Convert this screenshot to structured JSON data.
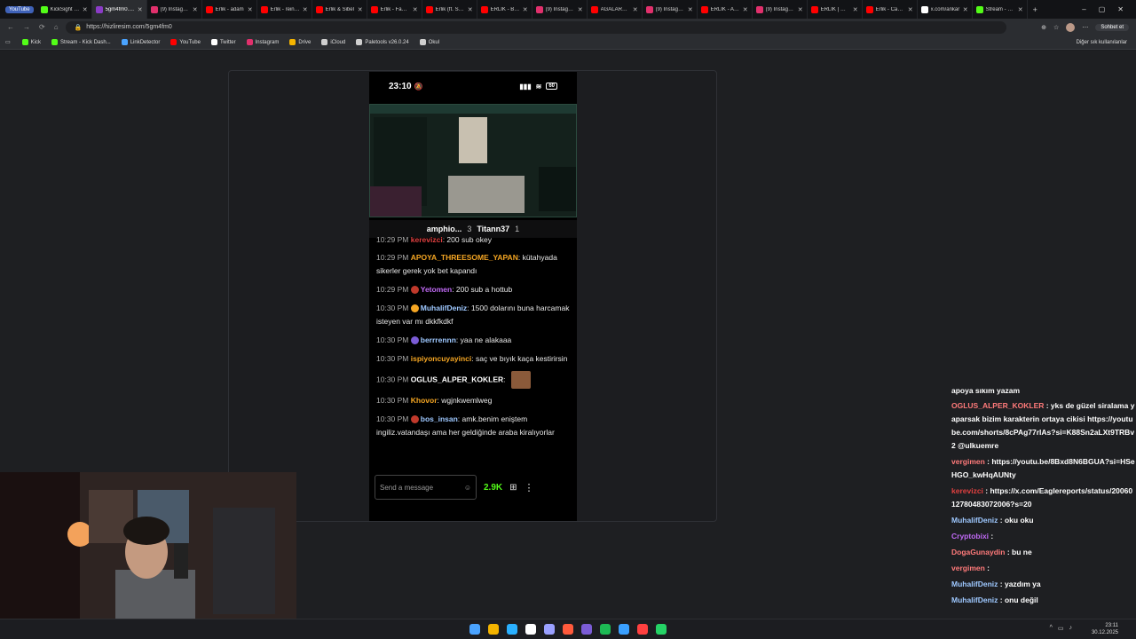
{
  "browser": {
    "youtube_pill": "YouTube",
    "tabs": [
      {
        "title": "KickSight Lin",
        "color": "#53fc18"
      },
      {
        "title": "5gm4fm0.pn",
        "color": "#8b3cc7",
        "active": true
      },
      {
        "title": "(9) Instagram",
        "color": "#e1306c"
      },
      {
        "title": "Erlik - adam",
        "color": "#ff0000"
      },
      {
        "title": "Erlik - reinca",
        "color": "#ff0000"
      },
      {
        "title": "Erlik & Sibel",
        "color": "#ff0000"
      },
      {
        "title": "Erlik - Family",
        "color": "#ff0000"
      },
      {
        "title": "Erlik (ft. Sibe",
        "color": "#ff0000"
      },
      {
        "title": "ERLİK - Bugü",
        "color": "#ff0000"
      },
      {
        "title": "(9) Instagram",
        "color": "#e1306c"
      },
      {
        "title": "AGALARLA C",
        "color": "#ff0000"
      },
      {
        "title": "(9) Instagram",
        "color": "#e1306c"
      },
      {
        "title": "ERLİK - ADA",
        "color": "#ff0000"
      },
      {
        "title": "(9) Instagram",
        "color": "#e1306c"
      },
      {
        "title": "ERLIK | Welc",
        "color": "#ff0000"
      },
      {
        "title": "Erlik - Cavs 1",
        "color": "#ff0000"
      },
      {
        "title": "x.com/ankar",
        "color": "#ffffff"
      },
      {
        "title": "Stream - Kick",
        "color": "#53fc18"
      }
    ],
    "url": "https://hizliresim.com/5gm4fm0",
    "chat_button": "Sohbet et",
    "bookmarks": [
      {
        "label": "Kick",
        "color": "#53fc18"
      },
      {
        "label": "Stream - Kick Dash...",
        "color": "#53fc18"
      },
      {
        "label": "LinkDetector",
        "color": "#4aa3ff"
      },
      {
        "label": "YouTube",
        "color": "#ff0000"
      },
      {
        "label": "Twitter",
        "color": "#ffffff"
      },
      {
        "label": "Instagram",
        "color": "#e1306c"
      },
      {
        "label": "Drive",
        "color": "#f4b400"
      },
      {
        "label": "iCloud",
        "color": "#cfcfcf"
      },
      {
        "label": "Paletools v26.0.24",
        "color": "#cfcfcf"
      },
      {
        "label": "Okul",
        "color": "#cfcfcf"
      }
    ],
    "other_bookmarks": "Diğer sık kullanılanlar"
  },
  "phone": {
    "time": "23:10",
    "battery": "60",
    "video_users": {
      "left": "amphio...",
      "left_count": "3",
      "right": "Titann37",
      "right_count": "1"
    },
    "partial_top": {
      "time": "10:29 PM",
      "user": "kerevizci",
      "text": ": 200 sub okey"
    },
    "messages": [
      {
        "time": "10:29 PM",
        "user": "APOYA_THREESOME_YAPAN",
        "color": "#f5a623",
        "badge": "",
        "text": ": kütahyada sikerler gerek yok bet kapandı"
      },
      {
        "time": "10:29 PM",
        "user": "Yetomen",
        "color": "#c06af5",
        "badge": "#c0392b",
        "text": ": 200 sub a hottub"
      },
      {
        "time": "10:30 PM",
        "user": "MuhalifDeniz",
        "color": "#9ec8ff",
        "badge": "#f5a623",
        "text": ": 1500 dolarını buna harcamak isteyen var mı dkkfkdkf"
      },
      {
        "time": "10:30 PM",
        "user": "berrrennn",
        "color": "#9ec8ff",
        "badge": "#7b5cd6",
        "text": ": yaa ne alakaaa"
      },
      {
        "time": "10:30 PM",
        "user": "ispiyoncuyayinci",
        "color": "#f5a623",
        "badge": "",
        "text": ": saç ve bıyık kaça kestirirsin"
      },
      {
        "time": "10:30 PM",
        "user": "OGLUS_ALPER_KOKLER",
        "color": "#ffffff",
        "badge": "",
        "text": ":",
        "emote": true
      },
      {
        "time": "10:30 PM",
        "user": "Khovor",
        "color": "#f5a623",
        "badge": "",
        "text": ": wgjnkwemlweg"
      },
      {
        "time": "10:30 PM",
        "user": "bos_insan",
        "color": "#9ec8ff",
        "badge": "#c0392b",
        "text": ": amk.benim eniştem ingiliz.vatandaşı ama her geldiğinde araba kiralıyorlar"
      }
    ],
    "input_placeholder": "Send a message",
    "kicks": "2.9K"
  },
  "side_chat": {
    "partial_top": "apoya sikim yazam",
    "messages": [
      {
        "user": "OGLUS_ALPER_KOKLER",
        "color": "#ff7a7a",
        "text": " : yks de güzel siralama yaparsak bizim karakterin ortaya cikisi https://youtube.com/shorts/8cPAg77rIAs?si=K88Sn2aLXt9TRBv2 @ulkuemre"
      },
      {
        "user": "vergimen",
        "color": "#ff7a7a",
        "text": " : https://youtu.be/8Bxd8N6BGUA?si=HSeHGO_kwHqAUNty"
      },
      {
        "user": "kerevizci",
        "color": "#e04040",
        "text": " : https://x.com/Eaglereports/status/2006012780483072006?s=20"
      },
      {
        "user": "MuhalifDeniz",
        "color": "#9ec8ff",
        "text": " : oku oku"
      },
      {
        "user": "Cryptobixi",
        "color": "#c06af5",
        "text": " :"
      },
      {
        "user": "DogaGunaydin",
        "color": "#ff7a7a",
        "text": " : bu ne"
      },
      {
        "user": "vergimen",
        "color": "#ff7a7a",
        "text": " :"
      },
      {
        "user": "MuhalifDeniz",
        "color": "#9ec8ff",
        "text": " : yazdım ya"
      },
      {
        "user": "MuhalifDeniz",
        "color": "#9ec8ff",
        "text": " : onu değil"
      }
    ]
  },
  "taskbar": {
    "time": "23:11",
    "date": "30.12.2025",
    "apps": [
      "#4aa3ff",
      "#f4b400",
      "#2ab0ff",
      "#ffffff",
      "#9aa0ff",
      "#ff5a3c",
      "#7b5cd6",
      "#1db954",
      "#3aa0ff",
      "#ff4040",
      "#25d366"
    ]
  }
}
